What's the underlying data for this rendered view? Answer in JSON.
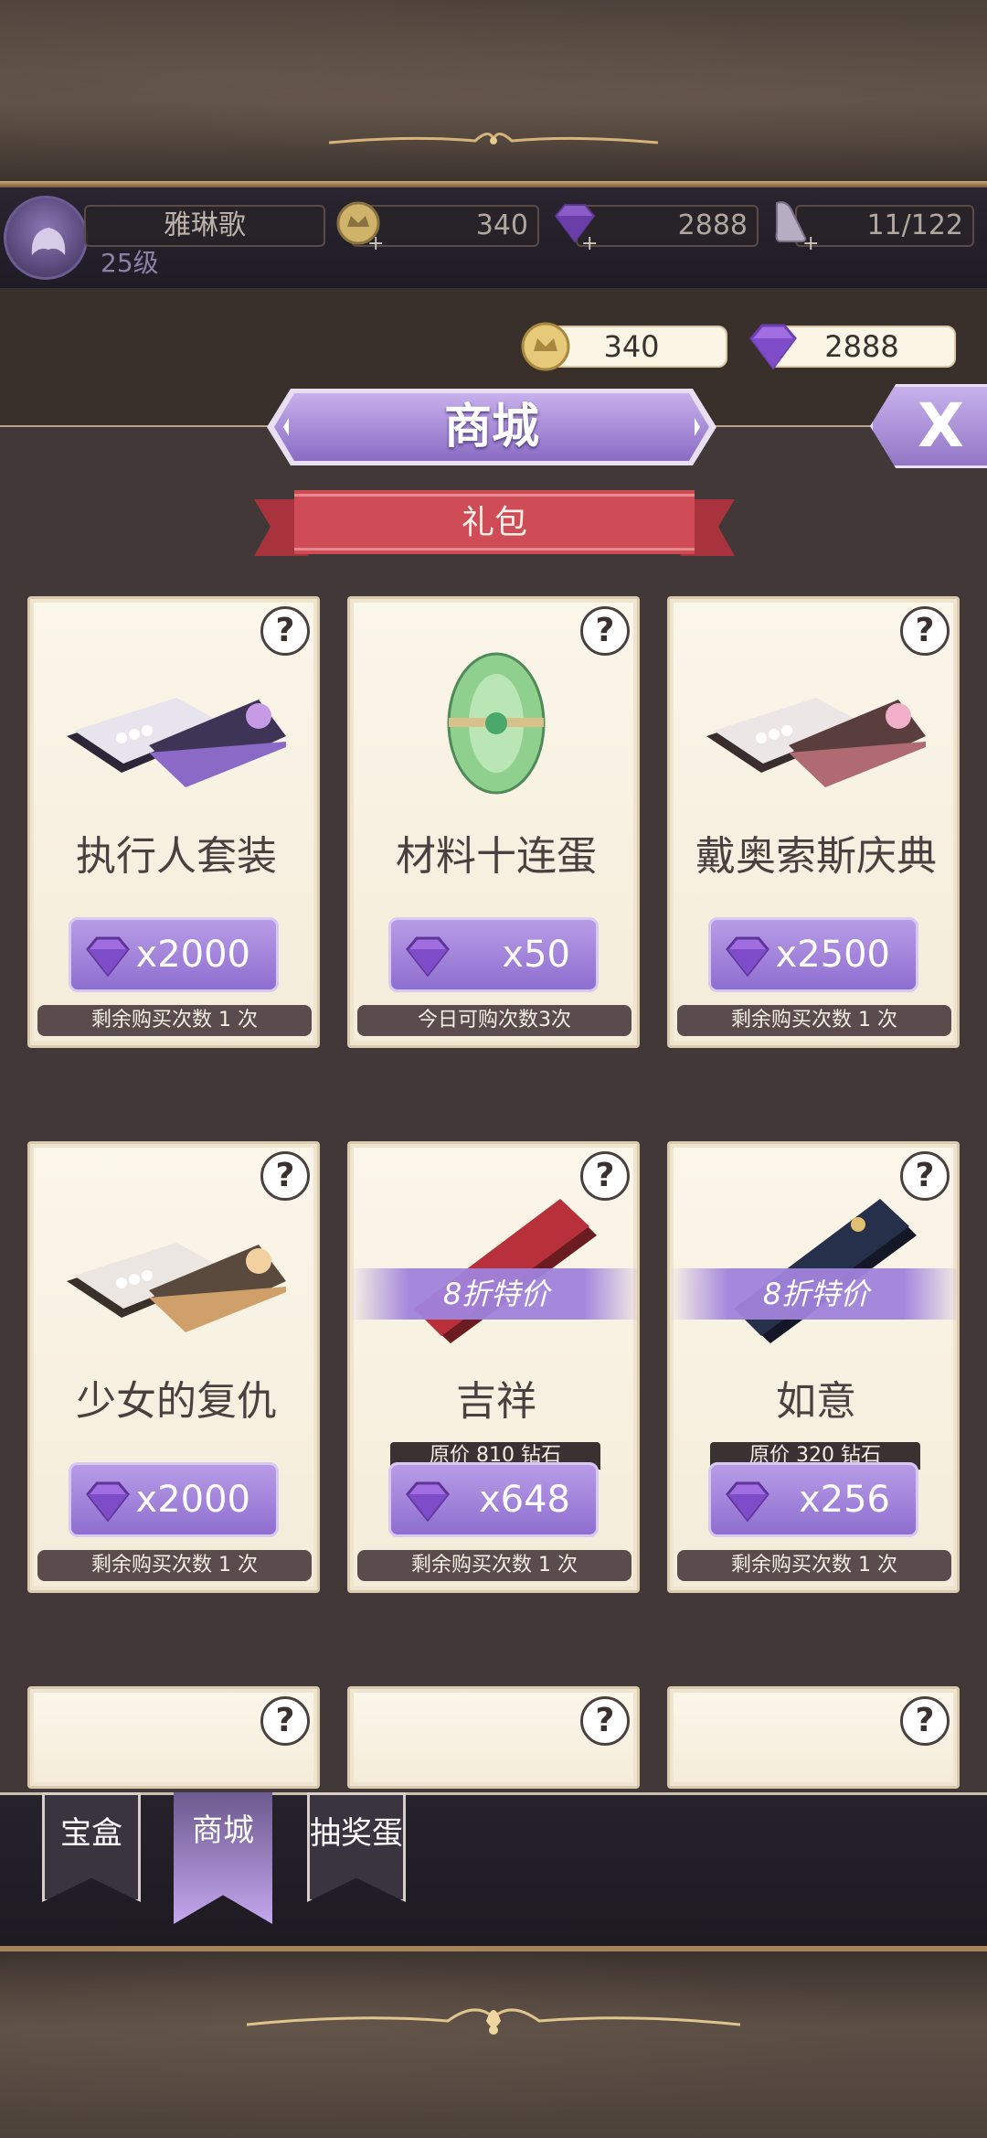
{
  "player": {
    "name": "雅琳歌",
    "level": "25级"
  },
  "top_stats": {
    "coins": "340",
    "gems": "2888",
    "stamina": "11/122"
  },
  "currency": {
    "coins": "340",
    "gems": "2888"
  },
  "header": {
    "title": "商城",
    "close_label": "X"
  },
  "section": {
    "label": "礼包"
  },
  "cards": [
    {
      "name": "执行人套装",
      "price": "x2000",
      "limit": "剩余购买次数 1 次"
    },
    {
      "name": "材料十连蛋",
      "price": "x50",
      "limit": "今日可购次数3次"
    },
    {
      "name": "戴奥索斯庆典",
      "price": "x2500",
      "limit": "剩余购买次数 1 次"
    },
    {
      "name": "少女的复仇",
      "price": "x2000",
      "limit": "剩余购买次数 1 次"
    },
    {
      "name": "吉祥",
      "price": "x648",
      "limit": "剩余购买次数 1 次",
      "discount": "8折特价",
      "original_price": "原价 810 钻石"
    },
    {
      "name": "如意",
      "price": "x256",
      "limit": "剩余购买次数 1 次",
      "discount": "8折特价",
      "original_price": "原价 320 钻石"
    }
  ],
  "help_label": "?",
  "tabs": [
    {
      "label": "宝盒",
      "active": false
    },
    {
      "label": "商城",
      "active": true
    },
    {
      "label": "抽奖蛋",
      "active": false
    }
  ],
  "colors": {
    "accent_purple": "#9a7ed6",
    "panel": "#423838",
    "card": "#f7f0e0",
    "ribbon": "#c9464f"
  }
}
